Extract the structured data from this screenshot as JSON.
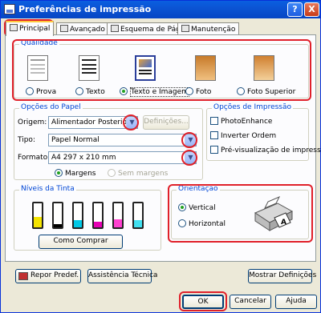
{
  "window": {
    "title": "Preferências de impressão",
    "help_label": "?",
    "close_label": "X"
  },
  "tabs": [
    {
      "label": "Principal"
    },
    {
      "label": "Avançado"
    },
    {
      "label": "Esquema de Página"
    },
    {
      "label": "Manutenção"
    }
  ],
  "quality": {
    "title": "Qualidade",
    "options": [
      {
        "label": "Prova",
        "selected": false
      },
      {
        "label": "Texto",
        "selected": false
      },
      {
        "label": "Texto e Imagem",
        "selected": true
      },
      {
        "label": "Foto",
        "selected": false
      },
      {
        "label": "Foto Superior",
        "selected": false
      }
    ]
  },
  "paper": {
    "title": "Opções do Papel",
    "source_label": "Origem:",
    "source_value": "Alimentador Posterior",
    "settings_button": "Definições...",
    "type_label": "Tipo:",
    "type_value": "Papel Normal",
    "format_label": "Formato:",
    "format_value": "A4 297 x 210 mm",
    "margins_label": "Margens",
    "no_margins_label": "Sem margens"
  },
  "print_options": {
    "title": "Opções de Impressão",
    "photo_enhance": "PhotoEnhance",
    "invert_order": "Inverter Ordem",
    "preview": "Pré-visualização de impressão"
  },
  "ink": {
    "title": "Níveis da Tinta",
    "buy_button": "Como Comprar",
    "levels": [
      {
        "color": "#f4e400",
        "level": 0.45
      },
      {
        "color": "#000000",
        "level": 0.15
      },
      {
        "color": "#00c8e6",
        "level": 0.3
      },
      {
        "color": "#e600b4",
        "level": 0.25
      },
      {
        "color": "#ff40d0",
        "level": 0.35
      },
      {
        "color": "#40e0f0",
        "level": 0.3
      }
    ]
  },
  "orientation": {
    "title": "Orientação",
    "portrait": "Vertical",
    "landscape": "Horizontal"
  },
  "bottom": {
    "reset": "Repor Predef.",
    "tech_support": "Assistência Técnica",
    "show_settings": "Mostrar Definições"
  },
  "dialog": {
    "ok": "OK",
    "cancel": "Cancelar",
    "help": "Ajuda"
  },
  "colors": {
    "highlight": "#e0202a",
    "group_title": "#0046d5",
    "titlebar": "#0a5fe0"
  }
}
